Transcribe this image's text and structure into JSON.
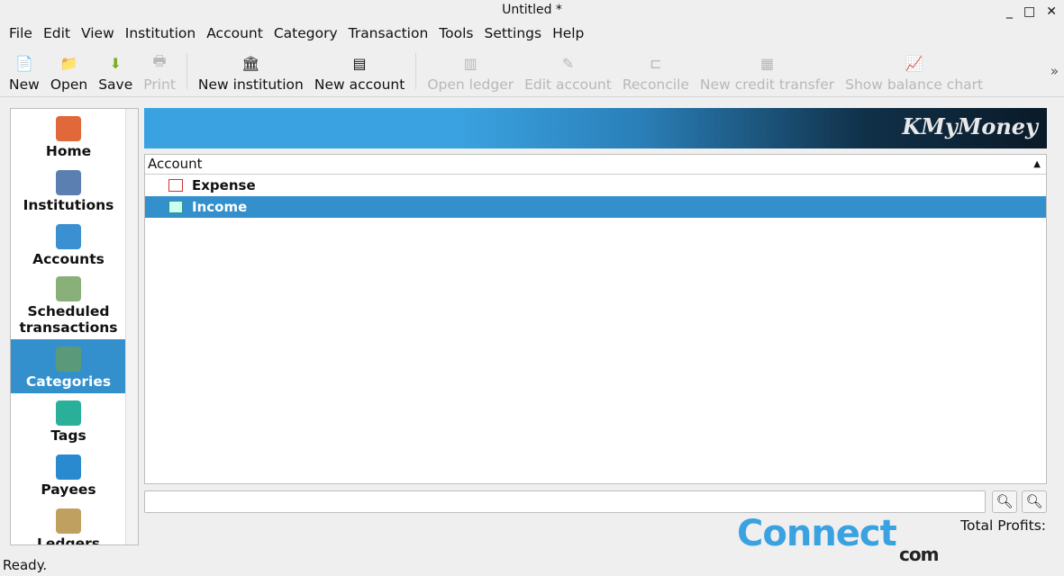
{
  "window": {
    "title": "Untitled *",
    "minimize": "_",
    "maximize": "□",
    "close": "✕"
  },
  "menu": [
    "File",
    "Edit",
    "View",
    "Institution",
    "Account",
    "Category",
    "Transaction",
    "Tools",
    "Settings",
    "Help"
  ],
  "toolbar": [
    {
      "label": "New",
      "icon": "new-file-icon",
      "enabled": true
    },
    {
      "label": "Open",
      "icon": "folder-open-icon",
      "enabled": true
    },
    {
      "label": "Save",
      "icon": "save-arrow-icon",
      "enabled": true
    },
    {
      "label": "Print",
      "icon": "printer-icon",
      "enabled": false
    },
    {
      "label": "New institution",
      "icon": "bank-icon",
      "enabled": true
    },
    {
      "label": "New account",
      "icon": "account-add-icon",
      "enabled": true
    },
    {
      "label": "Open ledger",
      "icon": "ledger-icon",
      "enabled": false
    },
    {
      "label": "Edit account",
      "icon": "edit-account-icon",
      "enabled": false
    },
    {
      "label": "Reconcile",
      "icon": "reconcile-icon",
      "enabled": false
    },
    {
      "label": "New credit transfer",
      "icon": "credit-transfer-icon",
      "enabled": false
    },
    {
      "label": "Show balance chart",
      "icon": "chart-icon",
      "enabled": false
    }
  ],
  "more": "»",
  "sidebar": [
    {
      "label": "Home",
      "color": "#e0683a"
    },
    {
      "label": "Institutions",
      "color": "#5a7fb0"
    },
    {
      "label": "Accounts",
      "color": "#3a90d0"
    },
    {
      "label": "Scheduled transactions",
      "color": "#8ab07a"
    },
    {
      "label": "Categories",
      "color": "#5a9a7a",
      "selected": true
    },
    {
      "label": "Tags",
      "color": "#2ab09a"
    },
    {
      "label": "Payees",
      "color": "#2a8ad0"
    },
    {
      "label": "Ledgers",
      "color": "#c0a060"
    }
  ],
  "banner": {
    "logo": "KMyMoney"
  },
  "tree": {
    "header": "Account",
    "rows": [
      {
        "label": "Expense",
        "selected": false
      },
      {
        "label": "Income",
        "selected": true
      }
    ]
  },
  "search": {
    "value": ""
  },
  "zoom_out": "−",
  "zoom_in": "+",
  "total_label": "Total Profits:",
  "status": "Ready.",
  "watermark": {
    "text": "Connect",
    "sub": "com"
  },
  "colors": {
    "selection": "#3390cc"
  }
}
